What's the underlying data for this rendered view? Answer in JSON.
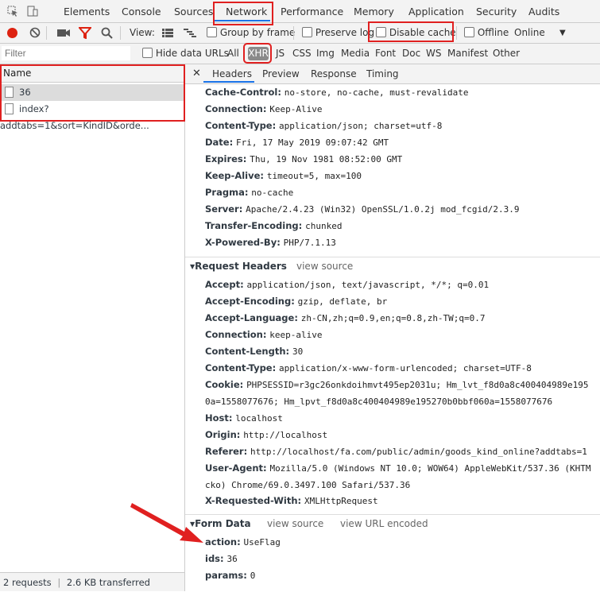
{
  "top_tabs": [
    "Elements",
    "Console",
    "Sources",
    "Network",
    "Performance",
    "Memory",
    "Application",
    "Security",
    "Audits"
  ],
  "toolbar": {
    "view_label": "View:",
    "group_by_frame": "Group by frame",
    "preserve_log": "Preserve log",
    "disable_cache": "Disable cache",
    "offline": "Offline",
    "online": "Online"
  },
  "filterbar": {
    "placeholder": "Filter",
    "hide_data_urls": "Hide data URLs",
    "types": [
      "All",
      "XHR",
      "JS",
      "CSS",
      "Img",
      "Media",
      "Font",
      "Doc",
      "WS",
      "Manifest",
      "Other"
    ]
  },
  "requests": {
    "column": "Name",
    "items": [
      "36",
      "index?addtabs=1&sort=KindID&orde..."
    ],
    "status": "2 requests",
    "transferred": "2.6 KB transferred"
  },
  "detail_tabs": [
    "Headers",
    "Preview",
    "Response",
    "Timing"
  ],
  "response_headers": [
    {
      "k": "Cache-Control:",
      "v": "no-store, no-cache, must-revalidate"
    },
    {
      "k": "Connection:",
      "v": "Keep-Alive"
    },
    {
      "k": "Content-Type:",
      "v": "application/json; charset=utf-8"
    },
    {
      "k": "Date:",
      "v": "Fri, 17 May 2019 09:07:42 GMT"
    },
    {
      "k": "Expires:",
      "v": "Thu, 19 Nov 1981 08:52:00 GMT"
    },
    {
      "k": "Keep-Alive:",
      "v": "timeout=5, max=100"
    },
    {
      "k": "Pragma:",
      "v": "no-cache"
    },
    {
      "k": "Server:",
      "v": "Apache/2.4.23 (Win32) OpenSSL/1.0.2j mod_fcgid/2.3.9"
    },
    {
      "k": "Transfer-Encoding:",
      "v": "chunked"
    },
    {
      "k": "X-Powered-By:",
      "v": "PHP/7.1.13"
    }
  ],
  "request_headers": {
    "title": "Request Headers",
    "view_source": "view source",
    "items": [
      {
        "k": "Accept:",
        "v": "application/json, text/javascript, */*; q=0.01"
      },
      {
        "k": "Accept-Encoding:",
        "v": "gzip, deflate, br"
      },
      {
        "k": "Accept-Language:",
        "v": "zh-CN,zh;q=0.9,en;q=0.8,zh-TW;q=0.7"
      },
      {
        "k": "Connection:",
        "v": "keep-alive"
      },
      {
        "k": "Content-Length:",
        "v": "30"
      },
      {
        "k": "Content-Type:",
        "v": "application/x-www-form-urlencoded; charset=UTF-8"
      },
      {
        "k": "Cookie:",
        "v": "PHPSESSID=r3gc26onkdoihmvt495ep2031u; Hm_lvt_f8d0a8c400404989e195"
      },
      {
        "k": "",
        "v": "0a=1558077676; Hm_lpvt_f8d0a8c400404989e195270b0bbf060a=1558077676"
      },
      {
        "k": "Host:",
        "v": "localhost"
      },
      {
        "k": "Origin:",
        "v": "http://localhost"
      },
      {
        "k": "Referer:",
        "v": "http://localhost/fa.com/public/admin/goods_kind_online?addtabs=1"
      },
      {
        "k": "User-Agent:",
        "v": "Mozilla/5.0 (Windows NT 10.0; WOW64) AppleWebKit/537.36 (KHTM"
      },
      {
        "k": "",
        "v": "cko) Chrome/69.0.3497.100 Safari/537.36"
      },
      {
        "k": "X-Requested-With:",
        "v": "XMLHttpRequest"
      }
    ]
  },
  "form_data": {
    "title": "Form Data",
    "view_source": "view source",
    "view_url_encoded": "view URL encoded",
    "items": [
      {
        "k": "action:",
        "v": "UseFlag"
      },
      {
        "k": "ids:",
        "v": "36"
      },
      {
        "k": "params:",
        "v": "0"
      }
    ]
  },
  "colors": {
    "highlight": "#e02020",
    "accent": "#1a73e8",
    "record": "#d21"
  }
}
